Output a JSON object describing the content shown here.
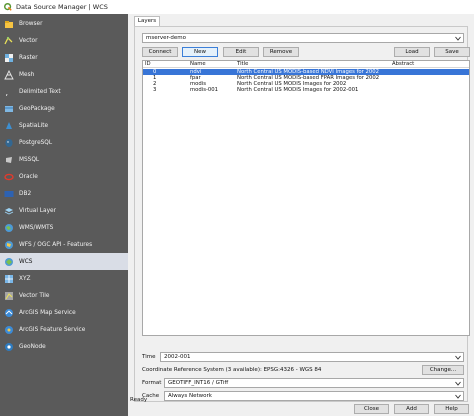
{
  "window": {
    "title": "Data Source Manager | WCS"
  },
  "sidebar": {
    "items": [
      {
        "label": "Browser",
        "icon": "browser-icon"
      },
      {
        "label": "Vector",
        "icon": "vector-icon"
      },
      {
        "label": "Raster",
        "icon": "raster-icon"
      },
      {
        "label": "Mesh",
        "icon": "mesh-icon"
      },
      {
        "label": "Delimited Text",
        "icon": "delimited-text-icon"
      },
      {
        "label": "GeoPackage",
        "icon": "geopackage-icon"
      },
      {
        "label": "SpatiaLite",
        "icon": "spatialite-icon"
      },
      {
        "label": "PostgreSQL",
        "icon": "postgresql-icon"
      },
      {
        "label": "MSSQL",
        "icon": "mssql-icon"
      },
      {
        "label": "Oracle",
        "icon": "oracle-icon"
      },
      {
        "label": "DB2",
        "icon": "db2-icon"
      },
      {
        "label": "Virtual Layer",
        "icon": "virtual-layer-icon"
      },
      {
        "label": "WMS/WMTS",
        "icon": "wms-icon"
      },
      {
        "label": "WFS / OGC API - Features",
        "icon": "wfs-icon"
      },
      {
        "label": "WCS",
        "icon": "wcs-icon"
      },
      {
        "label": "XYZ",
        "icon": "xyz-icon"
      },
      {
        "label": "Vector Tile",
        "icon": "vector-tile-icon"
      },
      {
        "label": "ArcGIS Map Service",
        "icon": "arcgis-map-icon"
      },
      {
        "label": "ArcGIS Feature Service",
        "icon": "arcgis-feature-icon"
      },
      {
        "label": "GeoNode",
        "icon": "geonode-icon"
      }
    ]
  },
  "tabs": {
    "layers": "Layers"
  },
  "connection": {
    "selected": "mserver-demo",
    "buttons": {
      "connect": "Connect",
      "new": "New",
      "edit": "Edit",
      "remove": "Remove",
      "load": "Load",
      "save": "Save"
    }
  },
  "table": {
    "columns": [
      "ID",
      "Name",
      "Title",
      "Abstract"
    ],
    "rows": [
      {
        "id": "0",
        "name": "ndvi",
        "title": "North Central US MODIS-based NDVI Images for 2002",
        "abstract": "",
        "selected": true
      },
      {
        "id": "1",
        "name": "fpar",
        "title": "North Central US MODIS-based FPAR Images for 2002",
        "abstract": "",
        "selected": false
      },
      {
        "id": "2",
        "name": "modis",
        "title": "North Central US MODIS Images for 2002",
        "abstract": "",
        "selected": false
      },
      {
        "id": "3",
        "name": "modis-001",
        "title": "North Central US MODIS Images for 2002-001",
        "abstract": "",
        "selected": false
      }
    ]
  },
  "options": {
    "time_label": "Time",
    "time_value": "2002-001",
    "crs_label": "Coordinate Reference System (3 available): EPSG:4326 - WGS 84",
    "change_button": "Change...",
    "format_label": "Format",
    "format_value": "GEOTIFF_INT16 / GTiff",
    "cache_label": "Cache",
    "cache_value": "Always Network"
  },
  "status": {
    "text": "Ready"
  },
  "footer": {
    "close": "Close",
    "add": "Add",
    "help": "Help"
  },
  "colors": {
    "sidebar_bg": "#5a5a5a",
    "selection": "#3875d7",
    "active_item": "#d9dde6"
  }
}
